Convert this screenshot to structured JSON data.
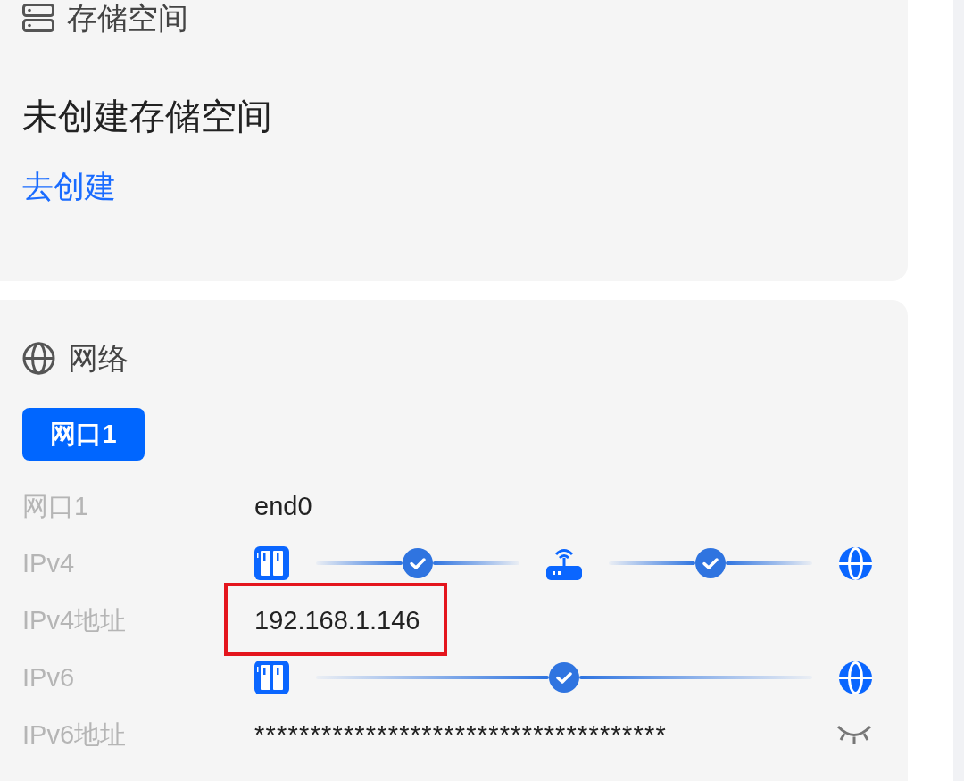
{
  "storage": {
    "title": "存储空间",
    "message": "未创建存储空间",
    "action": "去创建"
  },
  "network": {
    "title": "网络",
    "tabs": [
      {
        "label": "网口1",
        "selected": true
      }
    ],
    "rows": [
      {
        "kind": "text",
        "label": "网口1",
        "value": "end0",
        "highlighted": false
      },
      {
        "kind": "path",
        "label": "IPv4",
        "path": [
          {
            "kind": "device"
          },
          {
            "kind": "link",
            "ok": true
          },
          {
            "kind": "router"
          },
          {
            "kind": "link",
            "ok": true
          },
          {
            "kind": "internet"
          }
        ]
      },
      {
        "kind": "text",
        "label": "IPv4地址",
        "value": "192.168.1.146",
        "highlighted": true
      },
      {
        "kind": "path",
        "label": "IPv6",
        "path": [
          {
            "kind": "device"
          },
          {
            "kind": "link",
            "ok": true
          },
          {
            "kind": "internet"
          }
        ]
      },
      {
        "kind": "secret",
        "label": "IPv6地址",
        "value": "*************************************",
        "revealed": false
      }
    ]
  }
}
